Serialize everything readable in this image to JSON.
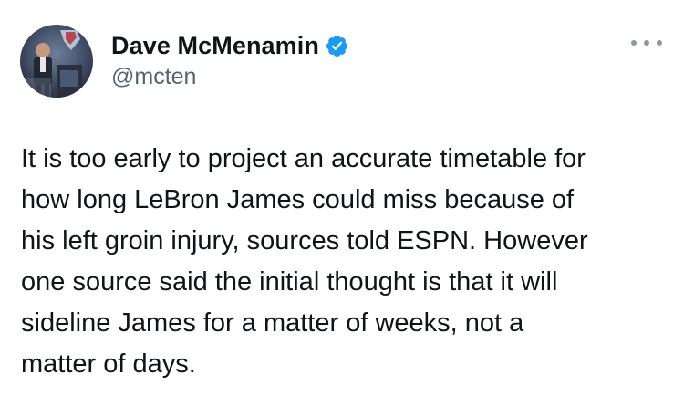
{
  "tweet": {
    "author": {
      "display_name": "Dave McMenamin",
      "handle": "@mcten",
      "verified": true,
      "avatar_icon": "profile-photo",
      "badge_icon": "verified-check-icon",
      "badge_color": "#1d9bf0"
    },
    "more_icon": "more-options-icon",
    "text_lines": [
      "It is too early to project an accurate timetable for",
      "how long LeBron James could miss because of",
      "his left groin injury, sources told ESPN. However",
      "one source said the initial thought is that it will",
      "sideline James for a matter of weeks, not a",
      "matter of days."
    ]
  }
}
